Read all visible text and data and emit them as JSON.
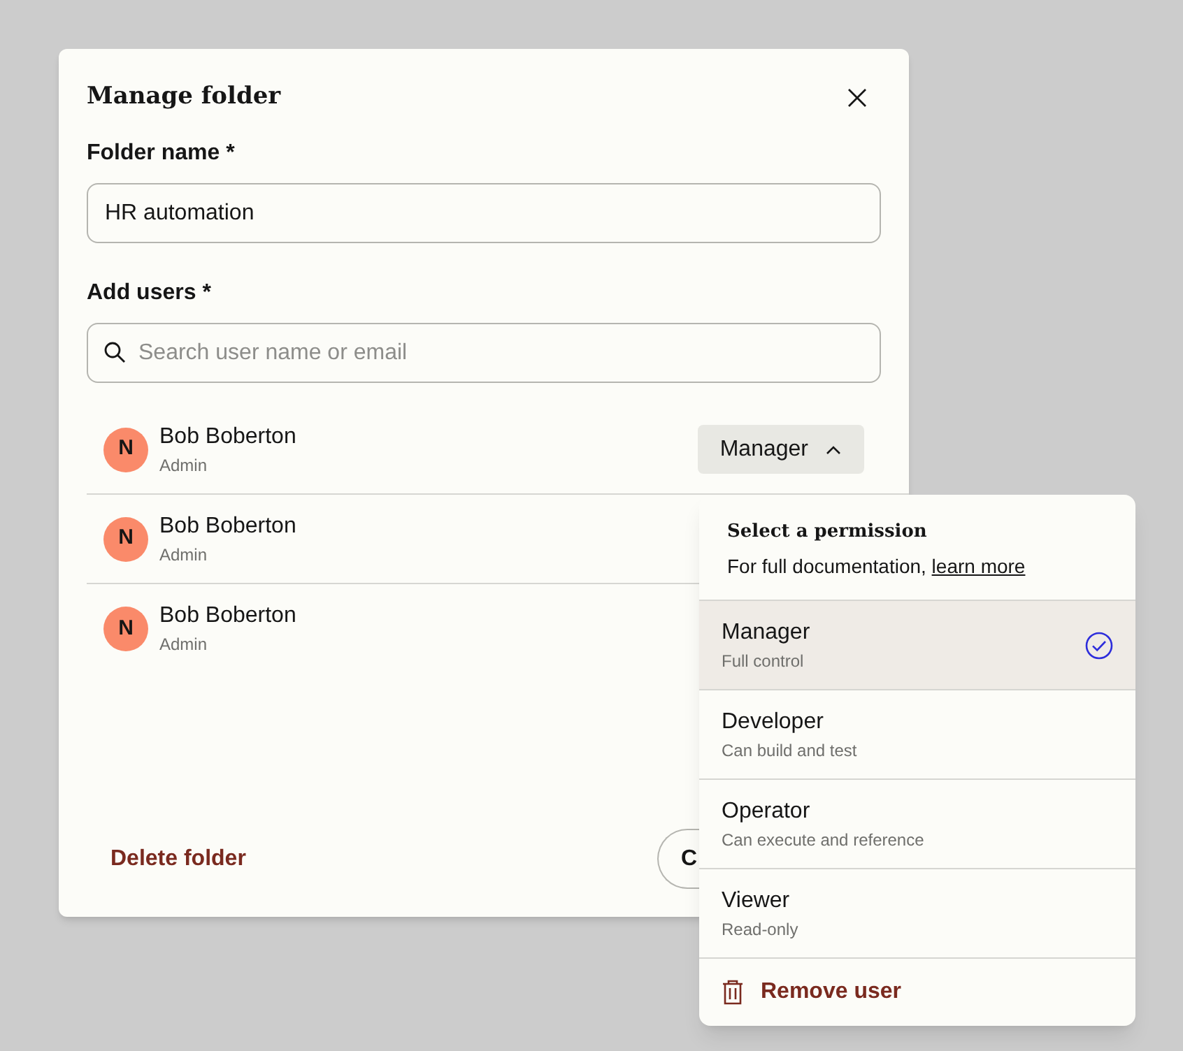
{
  "dialog": {
    "title": "Manage folder",
    "folder_name": {
      "label": "Folder name *",
      "value": "HR automation"
    },
    "add_users": {
      "label": "Add users *",
      "placeholder": "Search user name or email"
    },
    "users": [
      {
        "initial": "N",
        "name": "Bob Boberton",
        "role": "Admin",
        "permission_button": {
          "label": "Manager",
          "expanded": true
        }
      },
      {
        "initial": "N",
        "name": "Bob Boberton",
        "role": "Admin"
      },
      {
        "initial": "N",
        "name": "Bob Boberton",
        "role": "Admin"
      }
    ],
    "delete_button": "Delete folder",
    "cancel_button": "C"
  },
  "permission_menu": {
    "title": "Select a permission",
    "text": "For full documentation,",
    "link": "learn more",
    "items": [
      {
        "label": "Manager",
        "description": "Full control",
        "selected": true
      },
      {
        "label": "Developer",
        "description": "Can build and test",
        "selected": false
      },
      {
        "label": "Operator",
        "description": "Can execute and reference",
        "selected": false
      },
      {
        "label": "Viewer",
        "description": "Read-only",
        "selected": false
      }
    ],
    "remove_button": "Remove user"
  }
}
